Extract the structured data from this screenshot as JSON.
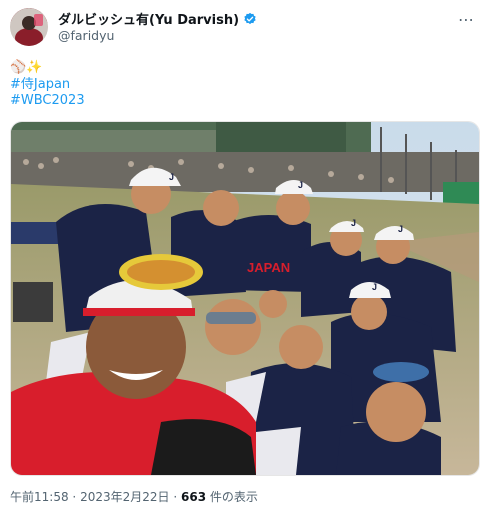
{
  "author": {
    "display_name": "ダルビッシュ有(Yu Darvish)",
    "handle": "@faridyu"
  },
  "tweet": {
    "emoji_line": "⚾✨",
    "hashtags": [
      "#侍Japan",
      "#WBC2023"
    ]
  },
  "photo": {
    "jersey_text": "JAPAN",
    "cap_letter": "J"
  },
  "footer": {
    "time": "午前11:58",
    "separator": "·",
    "date": "2023年2月22日",
    "views_count": "663",
    "views_label": "件の表示"
  },
  "colors": {
    "link": "#1d9bf0",
    "verified": "#1d9bf0",
    "secondary_text": "#536471",
    "team_navy": "#1b2346",
    "team_red": "#d81e2c"
  }
}
